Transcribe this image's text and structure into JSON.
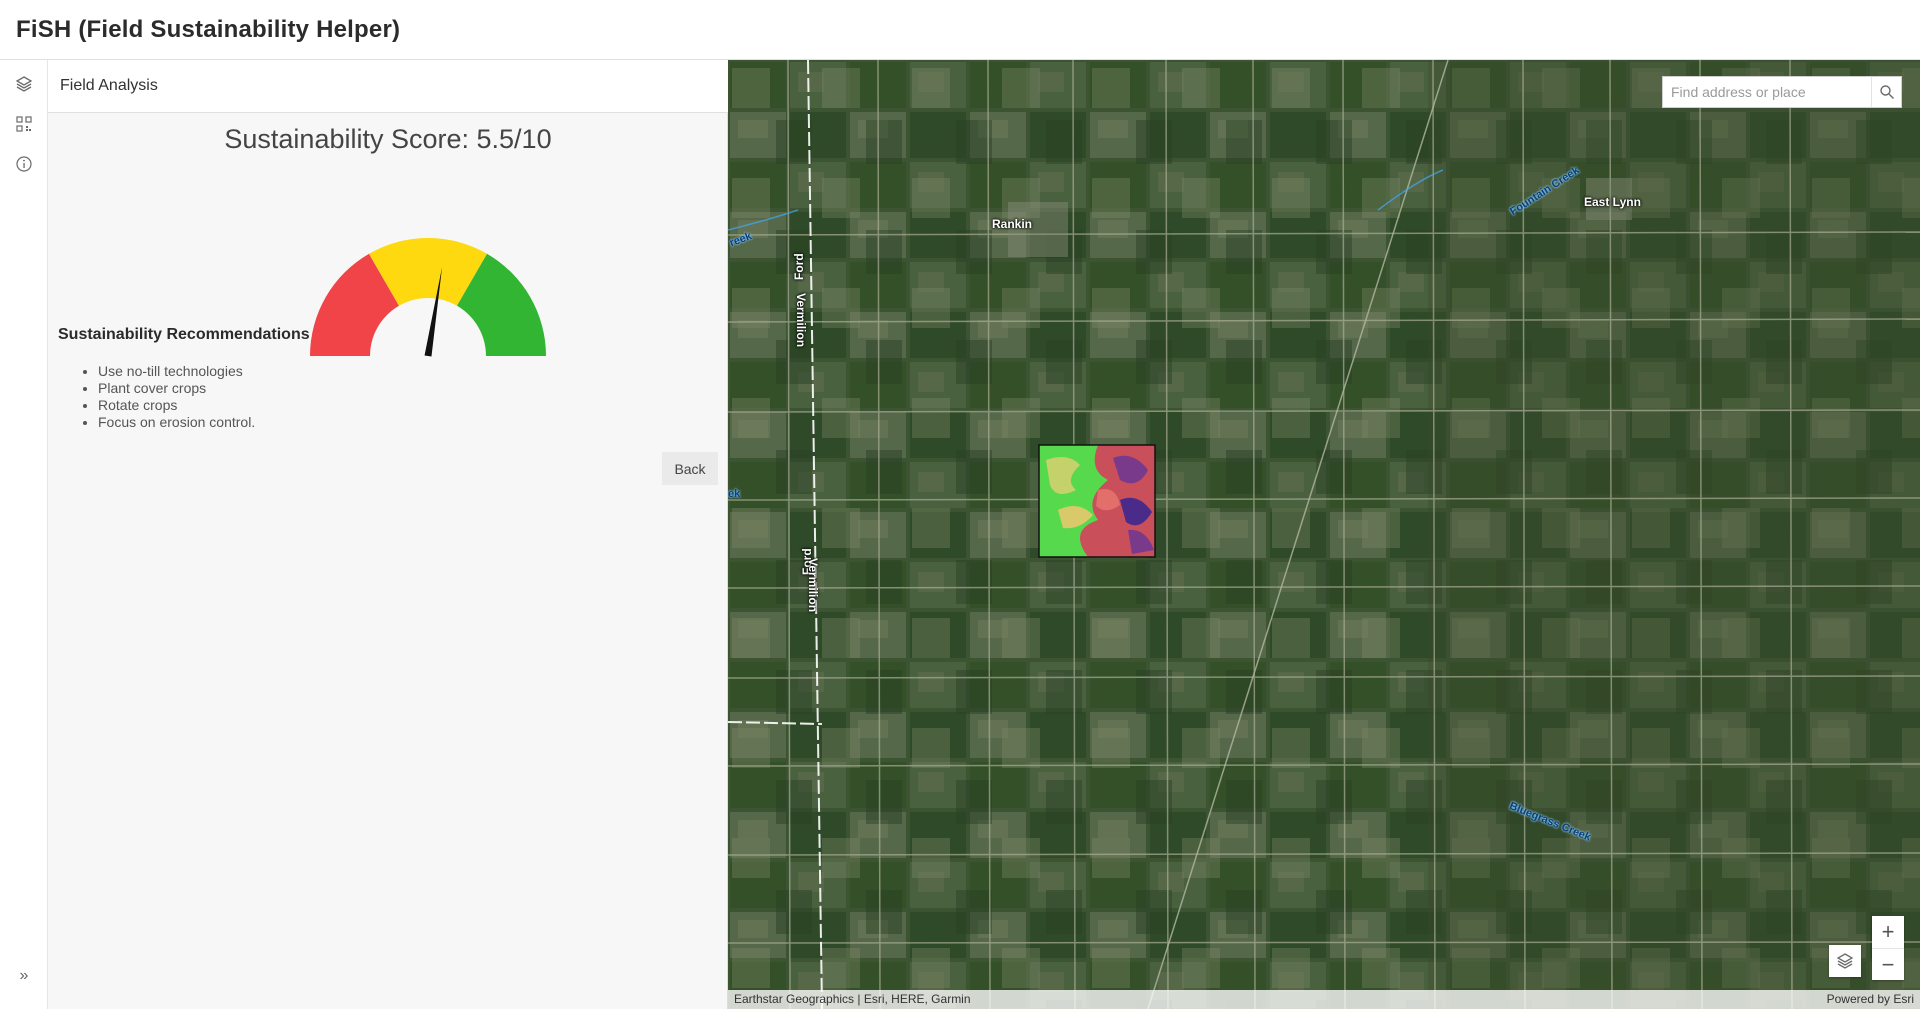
{
  "app": {
    "title": "FiSH (Field Sustainability Helper)"
  },
  "action_bar": {
    "items": [
      {
        "name": "layers",
        "icon": "layers-icon"
      },
      {
        "name": "legend",
        "icon": "legend-icon"
      },
      {
        "name": "about",
        "icon": "info-icon"
      }
    ],
    "collapse_icon": "chevrons-right-icon",
    "collapse_glyph": "»"
  },
  "panel": {
    "heading": "Field Analysis",
    "score_title": "Sustainability Score: 5.5/10",
    "score": {
      "value": 5.5,
      "max": 10
    },
    "gauge_colors": {
      "low": "#f04448",
      "mid": "#ffd90f",
      "high": "#33b534",
      "needle": "#111111"
    },
    "recommendations_title": "Sustainability Recommendations",
    "recommendations": [
      "Use no-till technologies",
      "Plant cover crops",
      "Rotate crops",
      "Focus on erosion control."
    ],
    "back_label": "Back"
  },
  "map": {
    "search": {
      "placeholder": "Find address or place",
      "value": ""
    },
    "zoom_in_glyph": "+",
    "zoom_out_glyph": "−",
    "labels": {
      "rankin": "Rankin",
      "east_lynn": "East Lynn",
      "fountain_creek": "Fountain Creek",
      "bluegrass_creek": "Bluegrass Creek",
      "creek_fragment": "reek",
      "creek_fragment_2": "ek",
      "road_ford": "Ford",
      "road_vermilion": "Vermilion"
    },
    "attribution_left": "Earthstar Geographics | Esri, HERE, Garmin",
    "attribution_right": "Powered by Esri"
  }
}
